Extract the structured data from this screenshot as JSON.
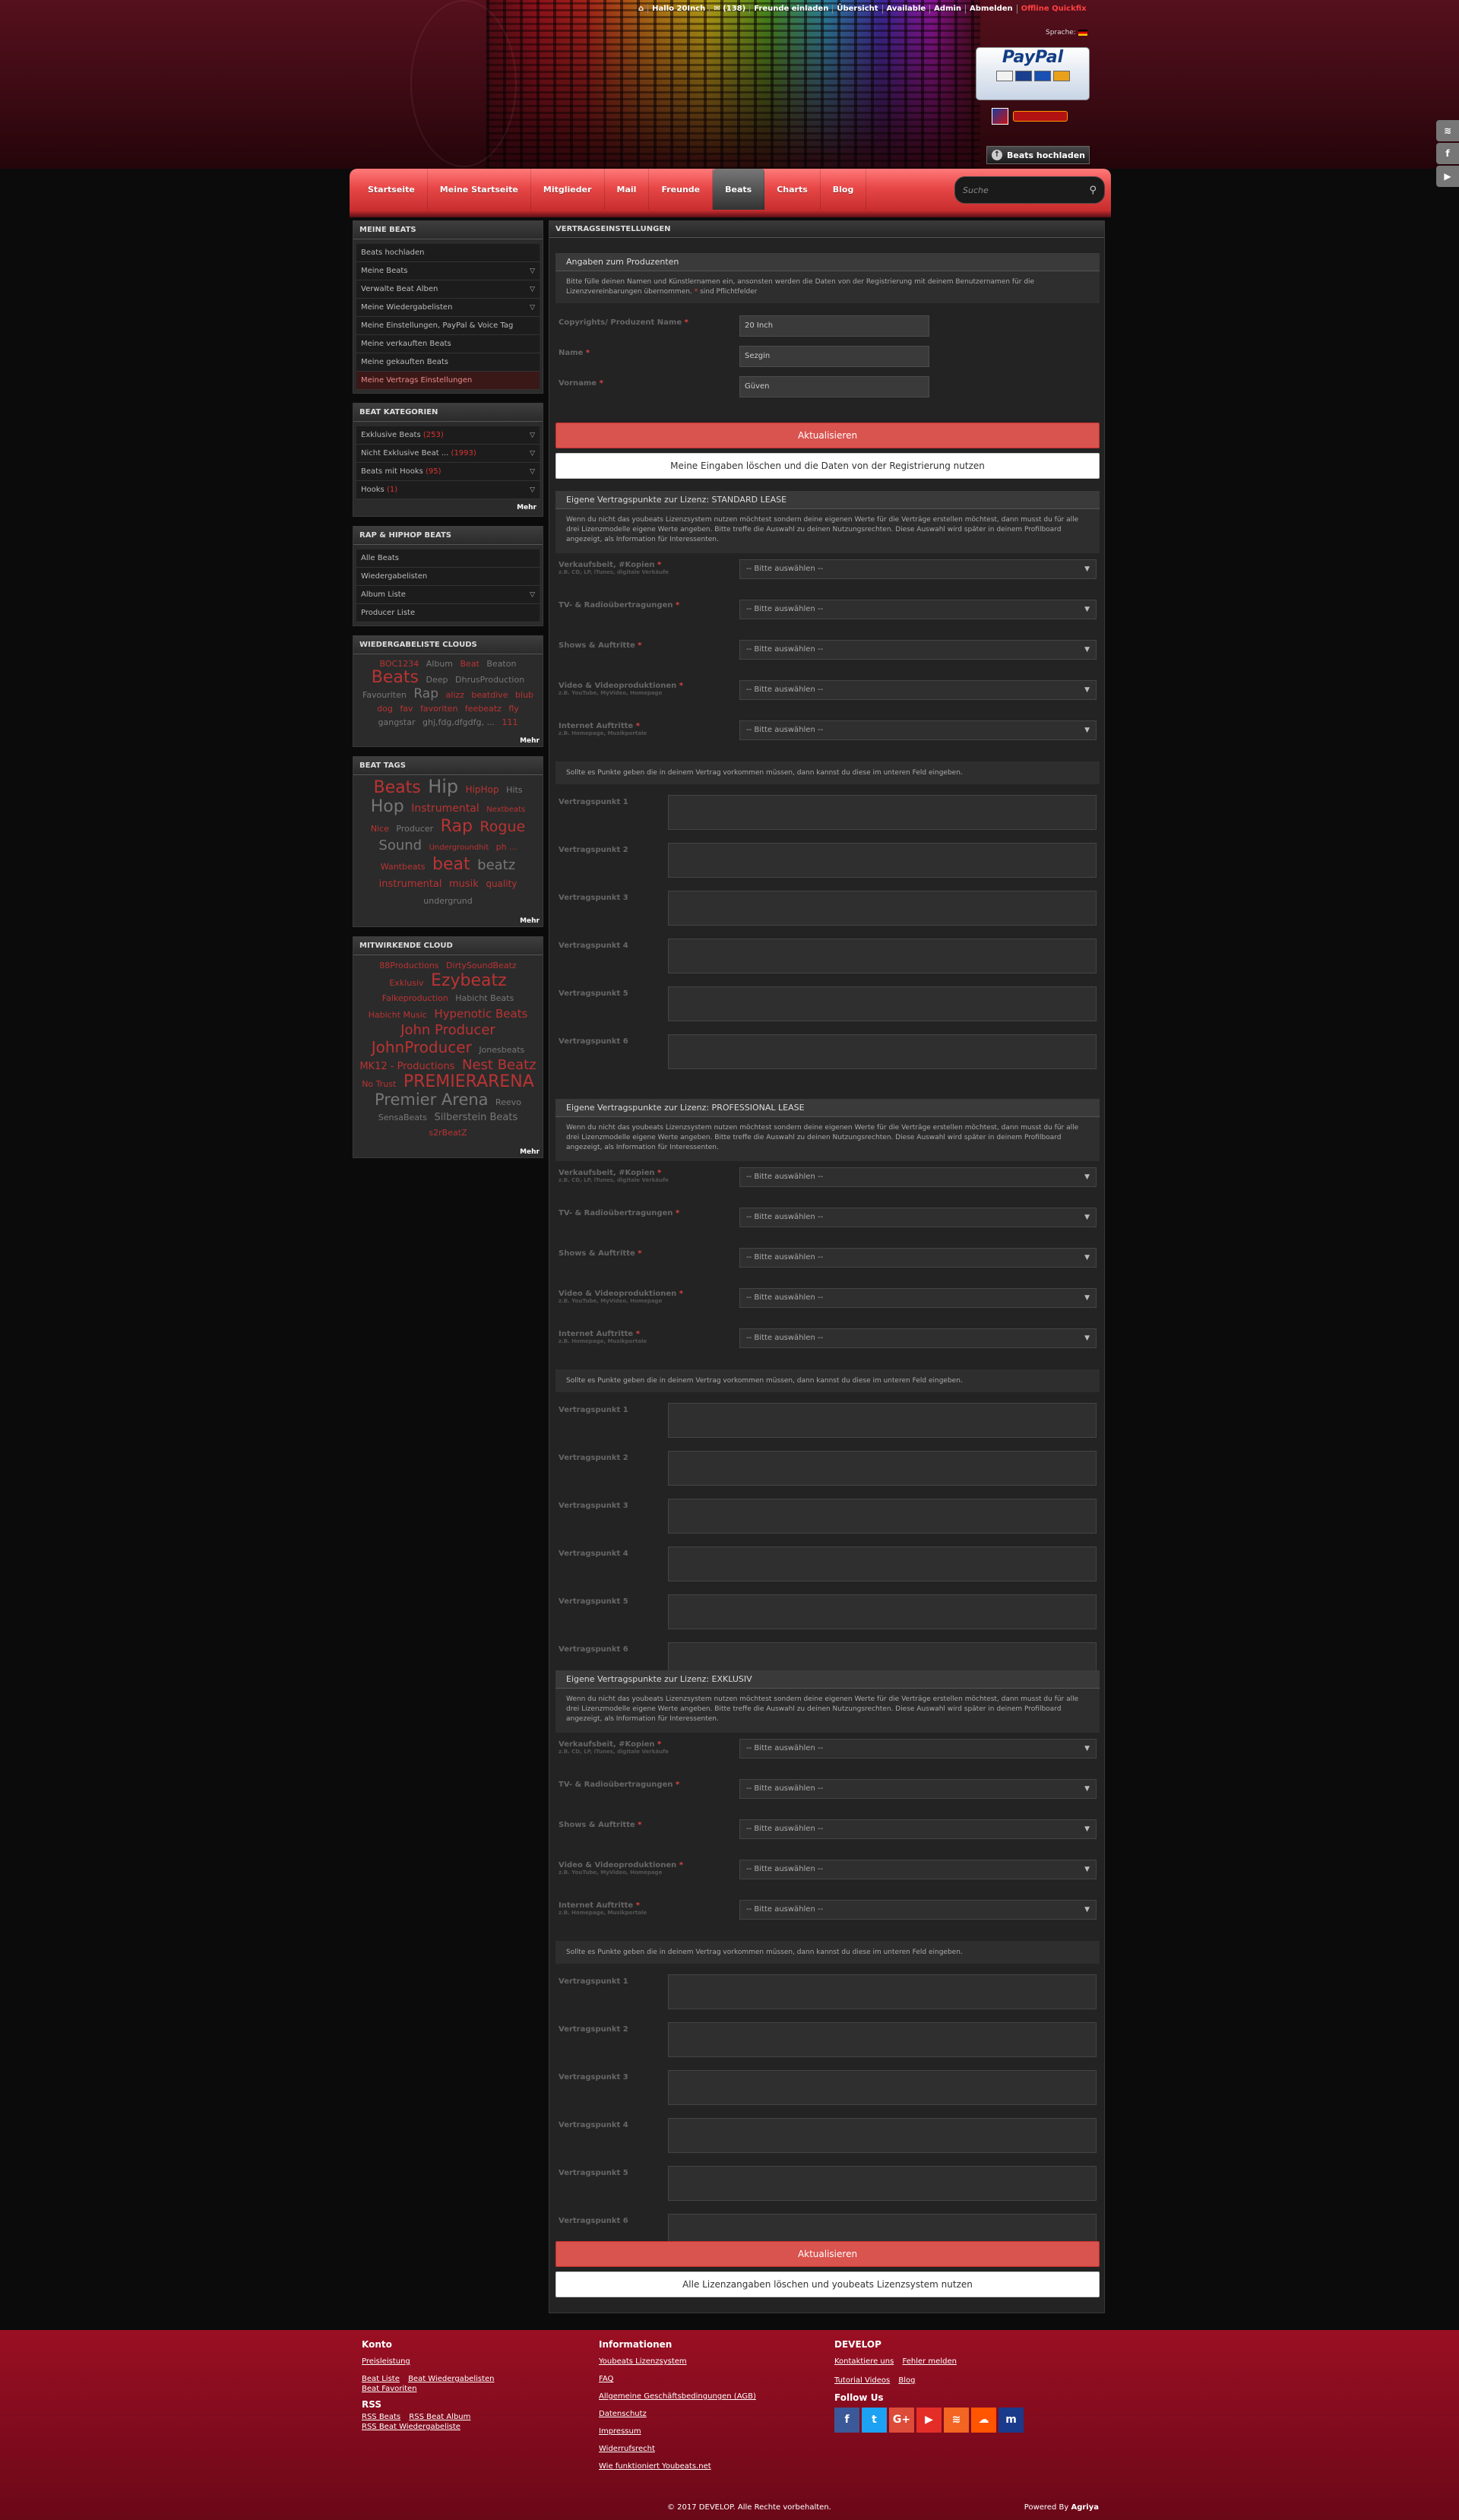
{
  "header": {
    "topbar": {
      "greeting": "Hallo 20Inch",
      "messages": "(138)",
      "invite": "Freunde einladen",
      "overview": "Übersicht",
      "status": "Available",
      "admin": "Admin",
      "logout": "Abmelden",
      "offline": "Offline Quickfix"
    },
    "language_label": "Sprache:",
    "paypal_label": "PayPal",
    "upload_button": "Beats hochladen"
  },
  "nav": {
    "items": [
      "Startseite",
      "Meine Startseite",
      "Mitglieder",
      "Mail",
      "Freunde",
      "Beats",
      "Charts",
      "Blog"
    ],
    "active": "Beats",
    "search_placeholder": "Suche"
  },
  "sidebar": {
    "meine_beats": {
      "title": "MEINE BEATS",
      "items": [
        "Beats hochladen",
        "Meine Beats",
        "Verwalte Beat Alben",
        "Meine Wiedergabelisten",
        "Meine Einstellungen, PayPal & Voice Tag",
        "Meine verkauften Beats",
        "Meine gekauften Beats",
        "Meine Vertrags Einstellungen"
      ]
    },
    "kategorien": {
      "title": "BEAT KATEGORIEN",
      "items": [
        {
          "label": "Exklusive Beats",
          "count": "(253)"
        },
        {
          "label": "Nicht Exklusive Beat ...",
          "count": "(1993)"
        },
        {
          "label": "Beats mit Hooks",
          "count": "(95)"
        },
        {
          "label": "Hooks",
          "count": "(1)"
        }
      ],
      "more": "Mehr"
    },
    "rap": {
      "title": "RAP & HIPHOP BEATS",
      "items": [
        "Alle Beats",
        "Wiedergabelisten",
        "Album Liste",
        "Producer Liste"
      ]
    },
    "playlist_cloud": {
      "title": "WIEDERGABELISTE CLOUDS",
      "words": [
        "BOC1234",
        "Album",
        "Beat",
        "Beaton",
        "Beats",
        "Deep",
        "DhrusProduction",
        "Favouriten",
        "Rap",
        "alizz",
        "beatdive",
        "blub",
        "dog",
        "fav",
        "favoriten",
        "feebeatz",
        "fly",
        "gangstar",
        "ghj,fdg,dfgdfg, ...",
        "111"
      ],
      "more": "Mehr"
    },
    "tags": {
      "title": "BEAT TAGS",
      "words": [
        "Beats",
        "Hip",
        "HipHop",
        "Hits",
        "Hop",
        "Instrumental",
        "Nextbeats",
        "Nice",
        "Producer",
        "Rap",
        "Rogue",
        "Sound",
        "Undergroundhit",
        "ph ...",
        "Wantbeats",
        "beat",
        "beatz",
        "instrumental",
        "musik",
        "quality",
        "undergrund"
      ],
      "more": "Mehr"
    },
    "contrib": {
      "title": "MITWIRKENDE CLOUD",
      "words": [
        "88Productions",
        "DirtySoundBeatz",
        "Exklusiv",
        "Ezybeatz",
        "Falkeproduction",
        "Habicht Beats",
        "Habicht Music",
        "Hypenotic Beats",
        "John Producer",
        "JohnProducer",
        "Jonesbeats",
        "MK12 - Productions",
        "Nest Beatz",
        "No Trust",
        "PREMIERARENA",
        "Premier Arena",
        "Reevo",
        "SensaBeats",
        "Silberstein Beats",
        "s2rBeatZ"
      ],
      "more": "Mehr"
    }
  },
  "content": {
    "title": "VERTRAGSEINSTELLUNGEN",
    "producer": {
      "title": "Angaben zum Produzenten",
      "note": "Bitte fülle deinen Namen und Künstlernamen ein, ansonsten werden die Daten von der Registrierung mit deinem Benutzernamen für die Lizenzvereinbarungen übernommen.",
      "required_suffix": "sind Pflichtfelder",
      "fields": [
        {
          "label": "Copyrights/ Produzent Name",
          "value": "20 Inch"
        },
        {
          "label": "Name",
          "value": "Sezgin"
        },
        {
          "label": "Vorname",
          "value": "Güven"
        }
      ],
      "update": "Aktualisieren",
      "reset": "Meine Eingaben löschen und die Daten von der Registrierung nutzen"
    },
    "license_note": "Wenn du nicht das youbeats Lizenzsystem nutzen möchtest sondern deine eigenen Werte für die Verträge erstellen möchtest, dann musst du für alle drei Lizenzmodelle eigene Werte angeben. Bitte treffe die Auswahl zu deinen Nutzungsrechten. Diese Auswahl wird später in deinem Profilboard angezeigt, als Information für Interessenten.",
    "extra_note": "Sollte es Punkte geben die in deinem Vertrag vorkommen müssen, dann kannst du diese im unteren Feld eingeben.",
    "select_placeholder": "-- Bitte auswählen --",
    "selects": [
      {
        "label": "Verkaufsbeit, #Kopien",
        "sub": "z.B. CD, LP, iTunes, digitale Verkäufe"
      },
      {
        "label": "TV- & Radioübertragungen",
        "sub": ""
      },
      {
        "label": "Shows & Auftritte",
        "sub": ""
      },
      {
        "label": "Video & Videoproduktionen",
        "sub": "z.B. YouTube, MyVideo, Homepage"
      },
      {
        "label": "Internet Auftritte",
        "sub": "z.B. Homepage, Musikportale"
      }
    ],
    "points": [
      "Vertragspunkt 1",
      "Vertragspunkt 2",
      "Vertragspunkt 3",
      "Vertragspunkt 4",
      "Vertragspunkt 5",
      "Vertragspunkt 6"
    ],
    "licenses": [
      "Eigene Vertragspunkte zur Lizenz: STANDARD LEASE",
      "Eigene Vertragspunkte zur Lizenz: PROFESSIONAL LEASE",
      "Eigene Vertragspunkte zur Lizenz: EXKLUSIV"
    ],
    "update": "Aktualisieren",
    "reset_all": "Alle Lizenzangaben löschen und youbeats Lizenzsystem nutzen"
  },
  "footer": {
    "konto": {
      "title": "Konto",
      "links": [
        "Preisleistung"
      ],
      "inline": [
        "Beat Liste",
        "Beat Wiedergabelisten",
        "Beat Favoriten"
      ],
      "rss_title": "RSS",
      "rss": [
        "RSS Beats",
        "RSS Beat Album",
        "RSS Beat Wiedergabeliste"
      ]
    },
    "info": {
      "title": "Informationen",
      "links": [
        "Youbeats Lizenzsystem",
        "FAQ",
        "Allgemeine Geschäftsbedingungen (AGB)",
        "Datenschutz",
        "Impressum",
        "Widerrufsrecht",
        "Wie funktioniert Youbeats.net"
      ]
    },
    "develop": {
      "title": "DEVELOP",
      "row1": [
        "Kontaktiere uns",
        "Fehler melden"
      ],
      "row2": [
        "Tutorial Videos",
        "Blog"
      ],
      "follow": "Follow Us",
      "social_icons": [
        "facebook-icon",
        "twitter-icon",
        "google-plus-icon",
        "youtube-icon",
        "rss-icon",
        "soundcloud-icon",
        "myspace-icon"
      ]
    },
    "copyright": "© 2017 DEVELOP. Alle Rechte vorbehalten.",
    "powered_prefix": "Powered By",
    "powered_by": "Agriya"
  }
}
